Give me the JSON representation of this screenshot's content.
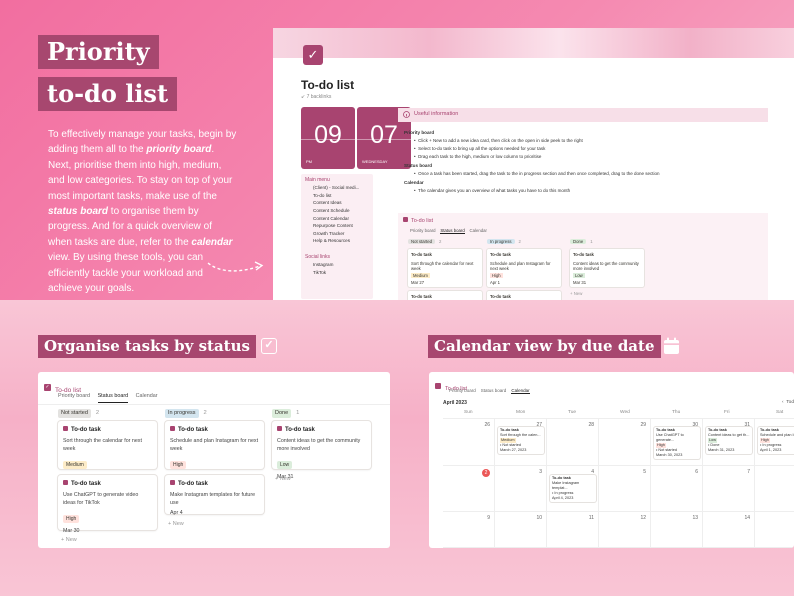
{
  "hero": {
    "title_line1": "Priority",
    "title_line2": "to-do list",
    "intro_parts": [
      {
        "t": "To effectively manage your tasks, begin by adding them all to the ",
        "b": false
      },
      {
        "t": "priority board",
        "b": true
      },
      {
        "t": ". Next, prioritise them into high, medium, and low categories. To stay on top of your most important tasks, make use of the ",
        "b": false
      },
      {
        "t": "status board",
        "b": true
      },
      {
        "t": " to organise them by progress. And for a quick overview of when tasks are due, refer to the ",
        "b": false
      },
      {
        "t": "calendar",
        "b": true
      },
      {
        "t": " view. By using these tools, you can efficiently tackle your workload and achieve your goals.",
        "b": false
      }
    ]
  },
  "notion_page": {
    "title": "To-do list",
    "backlinks": "↙ 7 backlinks",
    "date_cards": [
      {
        "num": "09",
        "label": "PM"
      },
      {
        "num": "07",
        "label": "WEDNESDAY"
      }
    ],
    "menu": {
      "heading": "Main menu",
      "items": [
        "(Client) - Social medi...",
        "To-do list",
        "Content Ideas",
        "Content Schedule",
        "Content Calendar",
        "Repurpose Content",
        "Growth Tracker",
        "Help & Resources"
      ],
      "social_heading": "Social links",
      "social_items": [
        "Instagram",
        "TikTok"
      ]
    },
    "useful_info": "Useful information",
    "info": {
      "priority_heading": "Priority board",
      "priority_bullets": [
        "Click + New to add a new idea card, then click on the open in side peek to the right",
        "Select to-do task to bring up all the options needed for your task",
        "Drag each task to the high, medium or low column to prioritise"
      ],
      "status_heading": "Status board",
      "status_bullets": [
        "Once a task has been started, drag the task to the in progress section and then once completed, drag to the done section"
      ],
      "calendar_heading": "Calendar",
      "calendar_bullets": [
        "The calendar gives you an overview of what tasks you have to do this month"
      ]
    },
    "small_board": {
      "title": "To-do list",
      "tabs": [
        "Priority board",
        "Status board",
        "Calendar"
      ],
      "columns": [
        {
          "label": "Not started",
          "count": "2"
        },
        {
          "label": "In progress",
          "count": "2"
        },
        {
          "label": "Done",
          "count": "1"
        }
      ],
      "cards": [
        {
          "t": "To-do task",
          "d": "Sort through the calendar for next week",
          "tag": "Medium",
          "date": "Mar 27"
        },
        {
          "t": "To-do task",
          "d": "Schedule and plan Instagram for next week",
          "tag": "High",
          "date": "Apr 1"
        },
        {
          "t": "To-do task",
          "d": "Content ideas to get the community more involved",
          "tag": "Low",
          "date": "Mar 31"
        }
      ],
      "new": "+ New"
    }
  },
  "status_section": {
    "heading": "Organise tasks by status",
    "panel_title": "To-do list",
    "tabs": [
      "Priority board",
      "Status board",
      "Calendar"
    ],
    "columns": [
      {
        "label": "Not started",
        "count": "2",
        "cards": [
          {
            "title": "To-do task",
            "desc": "Sort through the calendar for next week",
            "tag": "Medium",
            "date": "Mar 27"
          },
          {
            "title": "To-do task",
            "desc": "Use ChatGPT to generate video ideas for TikTok",
            "tag": "High",
            "date": "Mar 30"
          }
        ]
      },
      {
        "label": "In progress",
        "count": "2",
        "cards": [
          {
            "title": "To-do task",
            "desc": "Schedule and plan Instagram for next week",
            "tag": "High",
            "date": "Apr 1"
          },
          {
            "title": "To-do task",
            "desc": "Make Instagram templates for future use",
            "tag": "",
            "date": "Apr 4"
          }
        ]
      },
      {
        "label": "Done",
        "count": "1",
        "cards": [
          {
            "title": "To-do task",
            "desc": "Content ideas to get the community more involved",
            "tag": "Low",
            "date": "Mar 31"
          }
        ]
      }
    ],
    "new_label": "+ New"
  },
  "calendar_section": {
    "heading": "Calendar view by due date",
    "panel_title": "To-do list",
    "tabs": [
      "Priority board",
      "Status board",
      "Calendar"
    ],
    "month": "April 2023",
    "today_btn": "Tod",
    "days": [
      "Sun",
      "Mon",
      "Tue",
      "Wed",
      "Thu",
      "Fri",
      "Sat"
    ],
    "week1": [
      "26",
      "27",
      "28",
      "29",
      "30",
      "31",
      "1"
    ],
    "week2": [
      "2",
      "3",
      "4",
      "5",
      "6",
      "7",
      "8"
    ],
    "week3": [
      "9",
      "10",
      "11",
      "12",
      "13",
      "14",
      "15"
    ],
    "events": [
      {
        "col": 1,
        "row": 0,
        "lines": [
          "To-do task",
          "Sort through the calen...",
          "Medium",
          "• Not started",
          "March 27, 2023"
        ]
      },
      {
        "col": 4,
        "row": 0,
        "lines": [
          "To-do task",
          "Use ChatGPT to generate...",
          "High",
          "• Not started",
          "March 30, 2023"
        ]
      },
      {
        "col": 5,
        "row": 0,
        "lines": [
          "To-do task",
          "Content ideas to get th...",
          "Low",
          "• Done",
          "March 31, 2023"
        ]
      },
      {
        "col": 6,
        "row": 0,
        "lines": [
          "To-do task",
          "Schedule and plan Ins...",
          "High",
          "• In progress",
          "April 1, 2023"
        ]
      },
      {
        "col": 2,
        "row": 1,
        "lines": [
          "To-do task",
          "Make Instagram templat...",
          "• In progress",
          "April 4, 2023"
        ]
      }
    ]
  },
  "colors": {
    "accent": "#a84470",
    "not_started": "#e3e2e0",
    "in_progress": "#d3e5ef",
    "done": "#dbeddb",
    "high": "#ffe2dd",
    "medium": "#fdecc8",
    "low": "#dbeddb"
  }
}
